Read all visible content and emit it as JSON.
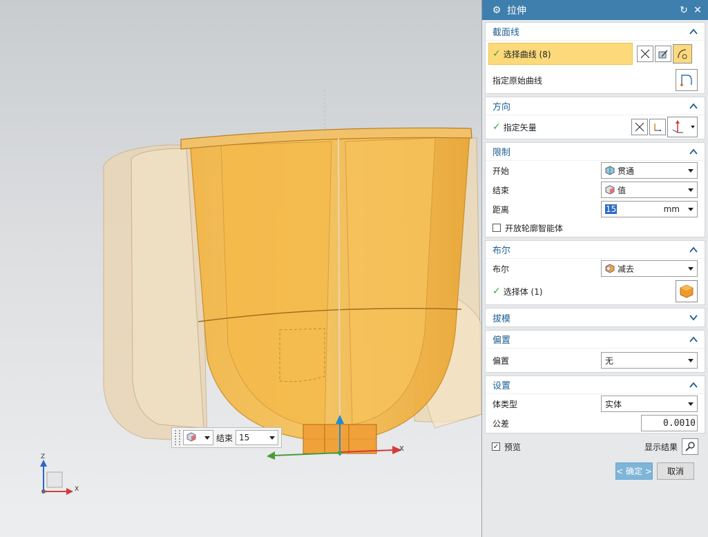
{
  "viewport": {
    "mini_toolbar": {
      "label": "结束",
      "value": "15"
    },
    "axes": {
      "z": "Z",
      "x": "X",
      "handle_x": "X"
    }
  },
  "dialog": {
    "title": "拉伸",
    "sections": {
      "section_curve": {
        "title": "截面线",
        "select_curve": "选择曲线 (8)",
        "original_curve": "指定原始曲线"
      },
      "direction": {
        "title": "方向",
        "vector": "指定矢量"
      },
      "limits": {
        "title": "限制",
        "start_label": "开始",
        "start_value": "贯通",
        "end_label": "结束",
        "end_value": "值",
        "distance_label": "距离",
        "distance_value": "15",
        "distance_unit": "mm",
        "open_profile": "开放轮廓智能体"
      },
      "boolean": {
        "title": "布尔",
        "bool_label": "布尔",
        "bool_value": "减去",
        "select_body": "选择体 (1)"
      },
      "draft": {
        "title": "拔模"
      },
      "offset": {
        "title": "偏置",
        "offset_label": "偏置",
        "offset_value": "无"
      },
      "settings": {
        "title": "设置",
        "body_type_label": "体类型",
        "body_type_value": "实体",
        "tolerance_label": "公差",
        "tolerance_value": "0.0010"
      }
    },
    "preview_label": "预览",
    "show_result": "显示结果",
    "ok_label": "< 确定 >",
    "cancel_label": "取消"
  }
}
